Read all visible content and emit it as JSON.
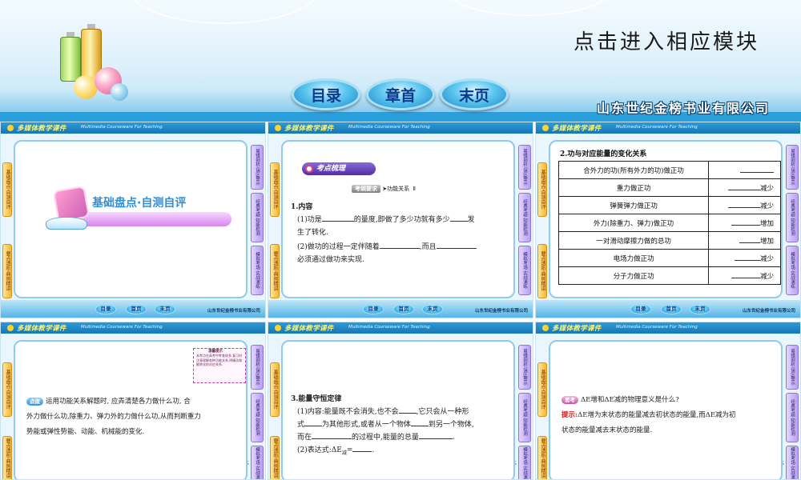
{
  "header": {
    "title": "点击进入相应模块",
    "company": "山东世纪金榜书业有限公司",
    "nav": {
      "catalog": "目录",
      "chapter": "章首",
      "end": "末页"
    }
  },
  "slide_common": {
    "logo": "多媒体教学课件",
    "logo_sub": "Multimedia Courseware For Teaching",
    "company": "山东世纪金榜书业有限公司",
    "nav": {
      "catalog": "目录",
      "chapter": "首页",
      "end": "末页"
    },
    "left_tabs": [
      "基础盘点·自测自评",
      "要点透析·典例精讲"
    ],
    "right_tabs": [
      "易错剖析·误区警示",
      "经典考题·知能检测",
      "模拟考场·实战演练"
    ]
  },
  "slide1": {
    "title": "基础盘点·自测自评"
  },
  "slide2": {
    "section": "考点梳理",
    "requirement_key": "考纲要求",
    "requirement": "功能关系",
    "level": "Ⅱ",
    "heading": "1.内容",
    "line1a": "(1)功是",
    "line1b": "的量度,即做了多少功就有多少",
    "line1c": "发",
    "line1d": "生了转化.",
    "line2a": "(2)做功的过程一定伴随着",
    "line2b": ",而且",
    "line2c": "必须通过做功来实现."
  },
  "slide3": {
    "heading": "2.功与对应能量的变化关系",
    "rows": [
      {
        "force": "合外力的功(所有外力的功)做正功",
        "change": ""
      },
      {
        "force": "重力做正功",
        "change": "减少"
      },
      {
        "force": "弹簧弹力做正功",
        "change": "减少"
      },
      {
        "force": "外力(除重力、弹力)做正功",
        "change": "增加"
      },
      {
        "force": "一对滑动摩擦力做的总功",
        "change": "增加"
      },
      {
        "force": "电场力做正功",
        "change": "减少"
      },
      {
        "force": "分子力做正功",
        "change": "减少"
      }
    ]
  },
  "slide4": {
    "note_title": "温馨提示",
    "note_text": "本考点在高考中考查较多,复习时注意理解各种功能关系,明确功和能转化的对应关系.",
    "tag": "点拨",
    "text1": "运用功能关系解题时, 应弄清楚各力做什么功, 合",
    "text2": "外力做什么功,除重力、弹力外的力做什么功,从而判断重力",
    "text3": "势能或弹性势能、动能、机械能的变化."
  },
  "slide5": {
    "heading": "3.能量守恒定律",
    "line1a": "(1)内容:能量既不会消失,也不会",
    "line1b": ",它只会从一种形",
    "line2a": "式",
    "line2b": "为其他形式,或者从一个物体",
    "line2c": "到另一个物体,",
    "line3a": "而在",
    "line3b": "的过程中,能量的总量",
    "line3c": ".",
    "line4a": "(2)表达式:ΔE",
    "line4b": "减",
    "line4c": "=",
    "line4d": "."
  },
  "slide6": {
    "tag": "思考",
    "question": "ΔE增和ΔE减的物理意义是什么?",
    "hint_label": "提示:",
    "hint1": "ΔE增为末状态的能量减去初状态的能量,而ΔE减为初",
    "hint2": "状态的能量减去末状态的能量."
  }
}
